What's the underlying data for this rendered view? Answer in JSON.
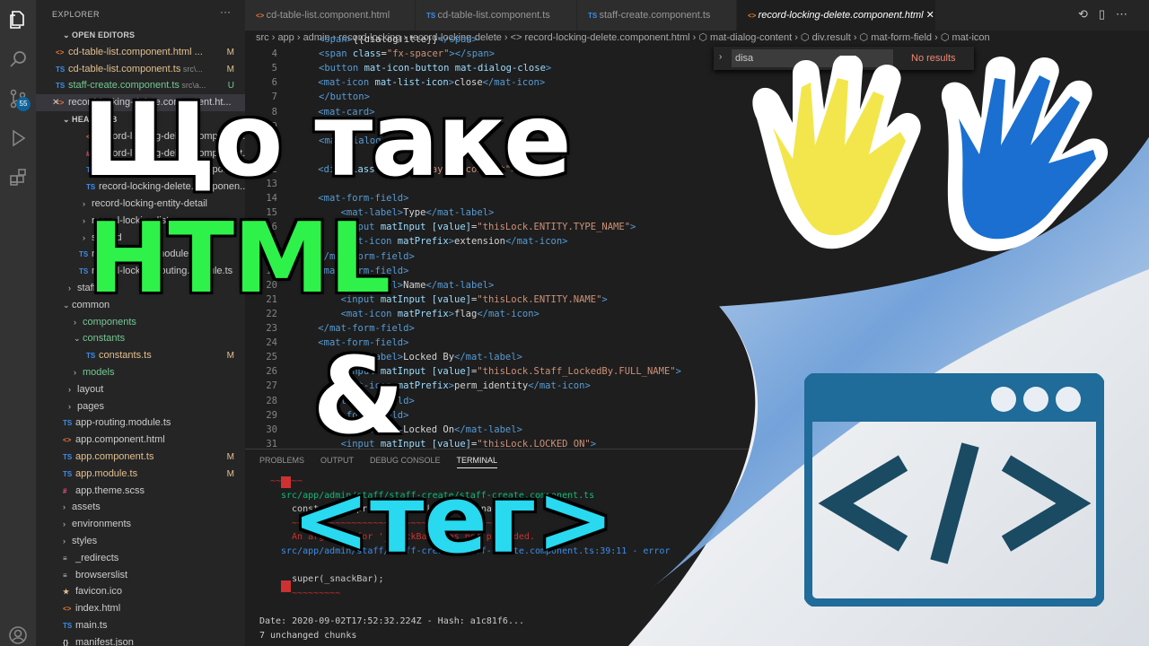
{
  "sidebar": {
    "title": "EXPLORER",
    "more": "···",
    "badge": "55",
    "rows": [
      {
        "label": "OPEN EDITORS",
        "chev": "⌄",
        "section": true
      },
      {
        "label": "cd-table-list.component.html ...",
        "icon": "<>",
        "status": "M"
      },
      {
        "label": "cd-table-list.component.ts",
        "path": "src\\...",
        "icon": "TS",
        "status": "M"
      },
      {
        "label": "staff-create.component.ts",
        "path": "src\\a...",
        "icon": "TS",
        "status": "U"
      },
      {
        "label": "record-locking-delete.component.ht...",
        "icon": "<>",
        "status": "",
        "close": "✕"
      },
      {
        "label": "HEAR.WEB",
        "chev": "⌄",
        "section": true
      },
      {
        "label": "record-locking-delete.componen...",
        "icon": "<>"
      },
      {
        "label": "record-locking-delete.component.scss",
        "icon": "#"
      },
      {
        "label": "record-locking-delete.componen...",
        "icon": "TS"
      },
      {
        "label": "record-locking-delete.componen...",
        "icon": "TS"
      },
      {
        "label": "record-locking-entity-detail",
        "chev": "›"
      },
      {
        "label": "record-locking-list",
        "chev": "›"
      },
      {
        "label": "shared",
        "chev": "›"
      },
      {
        "label": "record-locking.module.ts",
        "icon": "TS"
      },
      {
        "label": "record-locking-routing.module.ts",
        "icon": "TS"
      },
      {
        "label": "staff",
        "chev": "›"
      },
      {
        "label": "common",
        "chev": "⌄"
      },
      {
        "label": "components",
        "chev": "›"
      },
      {
        "label": "constants",
        "chev": "⌄"
      },
      {
        "label": "constants.ts",
        "icon": "TS",
        "status": "M"
      },
      {
        "label": "models",
        "chev": "›"
      },
      {
        "label": "layout",
        "chev": "›"
      },
      {
        "label": "pages",
        "chev": "›"
      },
      {
        "label": "app-routing.module.ts",
        "icon": "TS"
      },
      {
        "label": "app.component.html",
        "icon": "<>"
      },
      {
        "label": "app.component.ts",
        "icon": "TS",
        "status": "M"
      },
      {
        "label": "app.module.ts",
        "icon": "TS",
        "status": "M"
      },
      {
        "label": "app.theme.scss",
        "icon": "#"
      },
      {
        "label": "assets",
        "chev": "›"
      },
      {
        "label": "environments",
        "chev": "›"
      },
      {
        "label": "styles",
        "chev": "›"
      },
      {
        "label": "_redirects",
        "icon": "≡"
      },
      {
        "label": "browserslist",
        "icon": "≡"
      },
      {
        "label": "favicon.ico",
        "icon": "★"
      },
      {
        "label": "index.html",
        "icon": "<>"
      },
      {
        "label": "main.ts",
        "icon": "TS"
      },
      {
        "label": "manifest.json",
        "icon": "{}"
      }
    ]
  },
  "tabs": [
    {
      "label": "cd-table-list.component.html",
      "icon": "<>"
    },
    {
      "label": "cd-table-list.component.ts",
      "icon": "TS"
    },
    {
      "label": "staff-create.component.ts",
      "icon": "TS"
    },
    {
      "label": "record-locking-delete.component.html",
      "icon": "<>",
      "close": "✕"
    }
  ],
  "breadcrumb": "src › app › admin › record-locking › record-locking-delete › <> record-locking-delete.component.html › ⬡ mat-dialog-content › ⬡ div.result › ⬡ mat-form-field › ⬡ mat-icon",
  "find": {
    "value": "disa",
    "options": "Aa  ab  .*",
    "result": "No results"
  },
  "code": [
    {
      "n": "",
      "t": "<span>{{dialogTitle}}</span>"
    },
    {
      "n": "4",
      "t": "<span class=\"fx-spacer\"></span>"
    },
    {
      "n": "5",
      "t": "<button mat-icon-button mat-dialog-close>"
    },
    {
      "n": "6",
      "t": "    <mat-icon mat-list-icon>close</mat-icon>"
    },
    {
      "n": "7",
      "t": "</button>"
    },
    {
      "n": "8",
      "t": "    <mat-card>"
    },
    {
      "n": "9",
      "t": "</h4>"
    },
    {
      "n": "10",
      "t": "<mat-dialog-content>"
    },
    {
      "n": "11",
      "t": ""
    },
    {
      "n": "12",
      "t": "    <div class=\"record-layout-content\">"
    },
    {
      "n": "13",
      "t": ""
    },
    {
      "n": "14",
      "t": "    <mat-form-field>"
    },
    {
      "n": "15",
      "t": "        <mat-label>Type</mat-label>"
    },
    {
      "n": "16",
      "t": "        <input matInput [value]=\"thisLock.ENTITY.TYPE_NAME\">"
    },
    {
      "n": "17",
      "t": "        <mat-icon matPrefix>extension</mat-icon>"
    },
    {
      "n": "18",
      "t": "    </mat-form-field>"
    },
    {
      "n": "19",
      "t": "    <mat-form-field>"
    },
    {
      "n": "20",
      "t": "        <mat-label>Name</mat-label>"
    },
    {
      "n": "21",
      "t": "        <input matInput [value]=\"thisLock.ENTITY.NAME\">"
    },
    {
      "n": "22",
      "t": "        <mat-icon matPrefix>flag</mat-icon>"
    },
    {
      "n": "23",
      "t": "    </mat-form-field>"
    },
    {
      "n": "24",
      "t": "    <mat-form-field>"
    },
    {
      "n": "25",
      "t": "        <mat-label>Locked By</mat-label>"
    },
    {
      "n": "26",
      "t": "        <input matInput [value]=\"thisLock.Staff_LockedBy.FULL_NAME\">"
    },
    {
      "n": "27",
      "t": "        <mat-icon matPrefix>perm_identity</mat-icon>"
    },
    {
      "n": "28",
      "t": "    </mat-form-field>"
    },
    {
      "n": "29",
      "t": "    <mat-form-field>"
    },
    {
      "n": "30",
      "t": "        <mat-label>Locked On</mat-label>"
    },
    {
      "n": "31",
      "t": "        <input matInput [value]=\"thisLock.LOCKED_ON\">"
    }
  ],
  "panel": {
    "tabs": [
      "PROBLEMS",
      "OUTPUT",
      "DEBUG CONSOLE",
      "TERMINAL"
    ],
    "active": "TERMINAL",
    "lines": [
      {
        "t": "  ~~~~~~",
        "c": "#cd3131"
      },
      {
        "t": "src/app/admin/staff/staff-create/staff-create.component.ts",
        "c": "#0dbc79"
      },
      {
        "t": "  constructor(private _snackBar: MatSnackBar) {",
        "c": "#cccccc"
      },
      {
        "t": "  ~~~~~~~~~~~~~~~~~~~~~~~~~~~~~~~~~~~~~~~",
        "c": "#cd3131"
      },
      {
        "t": "  An argument for '_snackBar' was not provided.",
        "c": "#cd3131"
      },
      {
        "t": "src/app/admin/staff/staff-create/staff-create.component.ts:39:11 - error",
        "c": "#3b8eea"
      },
      {
        "t": "",
        "c": "#cccccc"
      },
      {
        "t": "      super(_snackBar);",
        "c": "#cccccc"
      },
      {
        "t": "      ~~~~~~~~~",
        "c": "#cd3131"
      },
      {
        "t": "",
        "c": "#cccccc"
      },
      {
        "t": "Date: 2020-09-02T17:52:32.224Z - Hash: a1c81f6...",
        "c": "#cccccc"
      },
      {
        "t": "7 unchanged chunks",
        "c": "#cccccc"
      }
    ]
  },
  "overlay": {
    "line1": "Що таке",
    "line2": "HTML",
    "line3": "&",
    "line4": "<тег>"
  },
  "colors": {
    "green": "#2ef24a",
    "cyan": "#28d9ef",
    "yellow_hand": "#f2e64c",
    "blue_hand": "#1a6fd1",
    "code_icon_blue": "#1f6b99",
    "code_icon_dark": "#1b4a63"
  },
  "icons": {
    "activity": [
      "files-icon",
      "search-icon",
      "source-control-icon",
      "run-debug-icon",
      "extensions-icon",
      "account-icon"
    ]
  }
}
